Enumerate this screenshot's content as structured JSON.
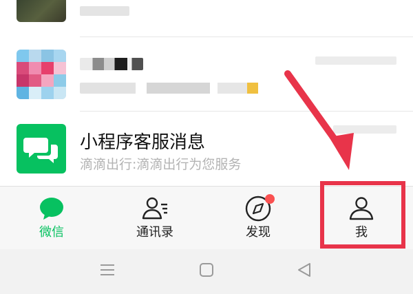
{
  "chat_list": {
    "rows": [
      {
        "title": "",
        "subtitle": ""
      },
      {
        "title": "",
        "subtitle": ""
      },
      {
        "title": "小程序客服消息",
        "subtitle": "滴滴出行:滴滴出行为您服务"
      }
    ]
  },
  "tabbar": {
    "tabs": [
      {
        "label": "微信",
        "icon": "chat-bubble-icon",
        "active": true
      },
      {
        "label": "通讯录",
        "icon": "contacts-icon",
        "active": false
      },
      {
        "label": "发现",
        "icon": "compass-icon",
        "active": false,
        "badge": true
      },
      {
        "label": "我",
        "icon": "person-icon",
        "active": false
      }
    ]
  },
  "annotation": {
    "color": "#e8344a",
    "target": "tab-me"
  },
  "colors": {
    "accent": "#07c160",
    "badge": "#fa5151"
  },
  "system_nav": {
    "icons": [
      "menu-icon",
      "home-icon",
      "back-icon"
    ]
  }
}
